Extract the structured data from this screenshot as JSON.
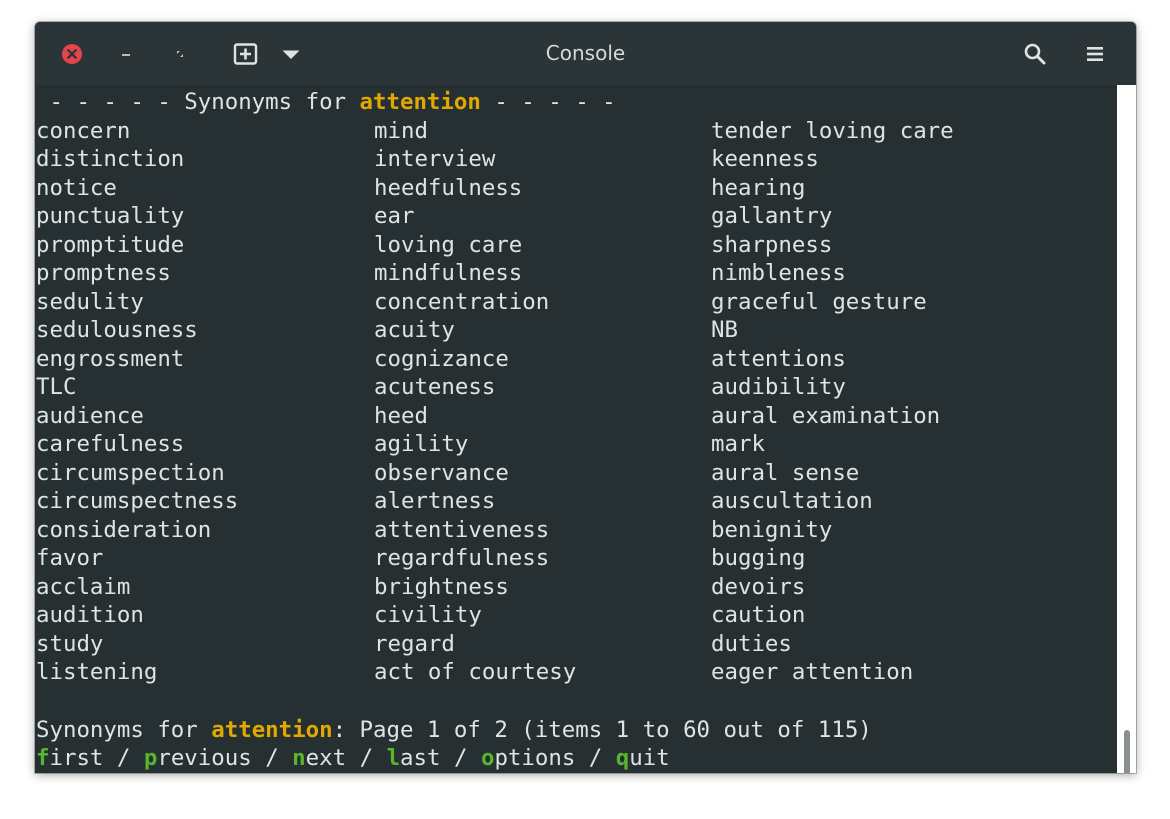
{
  "window": {
    "title": "Console"
  },
  "header": {
    "prefix": " - - - - - Synonyms for ",
    "word": "attention",
    "suffix": " - - - - -"
  },
  "columns": [
    [
      "concern",
      "distinction",
      "notice",
      "punctuality",
      "promptitude",
      "promptness",
      "sedulity",
      "sedulousness",
      "engrossment",
      "TLC",
      "audience",
      "carefulness",
      "circumspection",
      "circumspectness",
      "consideration",
      "favor",
      "acclaim",
      "audition",
      "study",
      "listening"
    ],
    [
      "mind",
      "interview",
      "heedfulness",
      "ear",
      "loving care",
      "mindfulness",
      "concentration",
      "acuity",
      "cognizance",
      "acuteness",
      "heed",
      "agility",
      "observance",
      "alertness",
      "attentiveness",
      "regardfulness",
      "brightness",
      "civility",
      "regard",
      "act of courtesy"
    ],
    [
      "tender loving care",
      "keenness",
      "hearing",
      "gallantry",
      "sharpness",
      "nimbleness",
      "graceful gesture",
      "NB",
      "attentions",
      "audibility",
      "aural examination",
      "mark",
      "aural sense",
      "auscultation",
      "benignity",
      "bugging",
      "devoirs",
      "caution",
      "duties",
      "eager attention"
    ]
  ],
  "status": {
    "prefix": "Synonyms for ",
    "word": "attention",
    "rest": ": Page 1 of 2 (items 1 to 60 out of 115)"
  },
  "menu": [
    {
      "key": "f",
      "rest": "irst"
    },
    {
      "key": "p",
      "rest": "revious"
    },
    {
      "key": "n",
      "rest": "ext"
    },
    {
      "key": "l",
      "rest": "ast"
    },
    {
      "key": "o",
      "rest": "ptions"
    },
    {
      "key": "q",
      "rest": "uit"
    }
  ],
  "menu_separator": " / ",
  "colors": {
    "highlight": "#e0a800",
    "menu_key": "#5ab52e",
    "close_button": "#e5444a",
    "terminal_bg": "#263033"
  },
  "icons": {
    "close": "close-icon",
    "minimize": "minimize-icon",
    "restore": "restore-icon",
    "new_tab": "new-tab-icon",
    "dropdown": "chevron-down-icon",
    "search": "search-icon",
    "menu": "hamburger-menu-icon"
  }
}
